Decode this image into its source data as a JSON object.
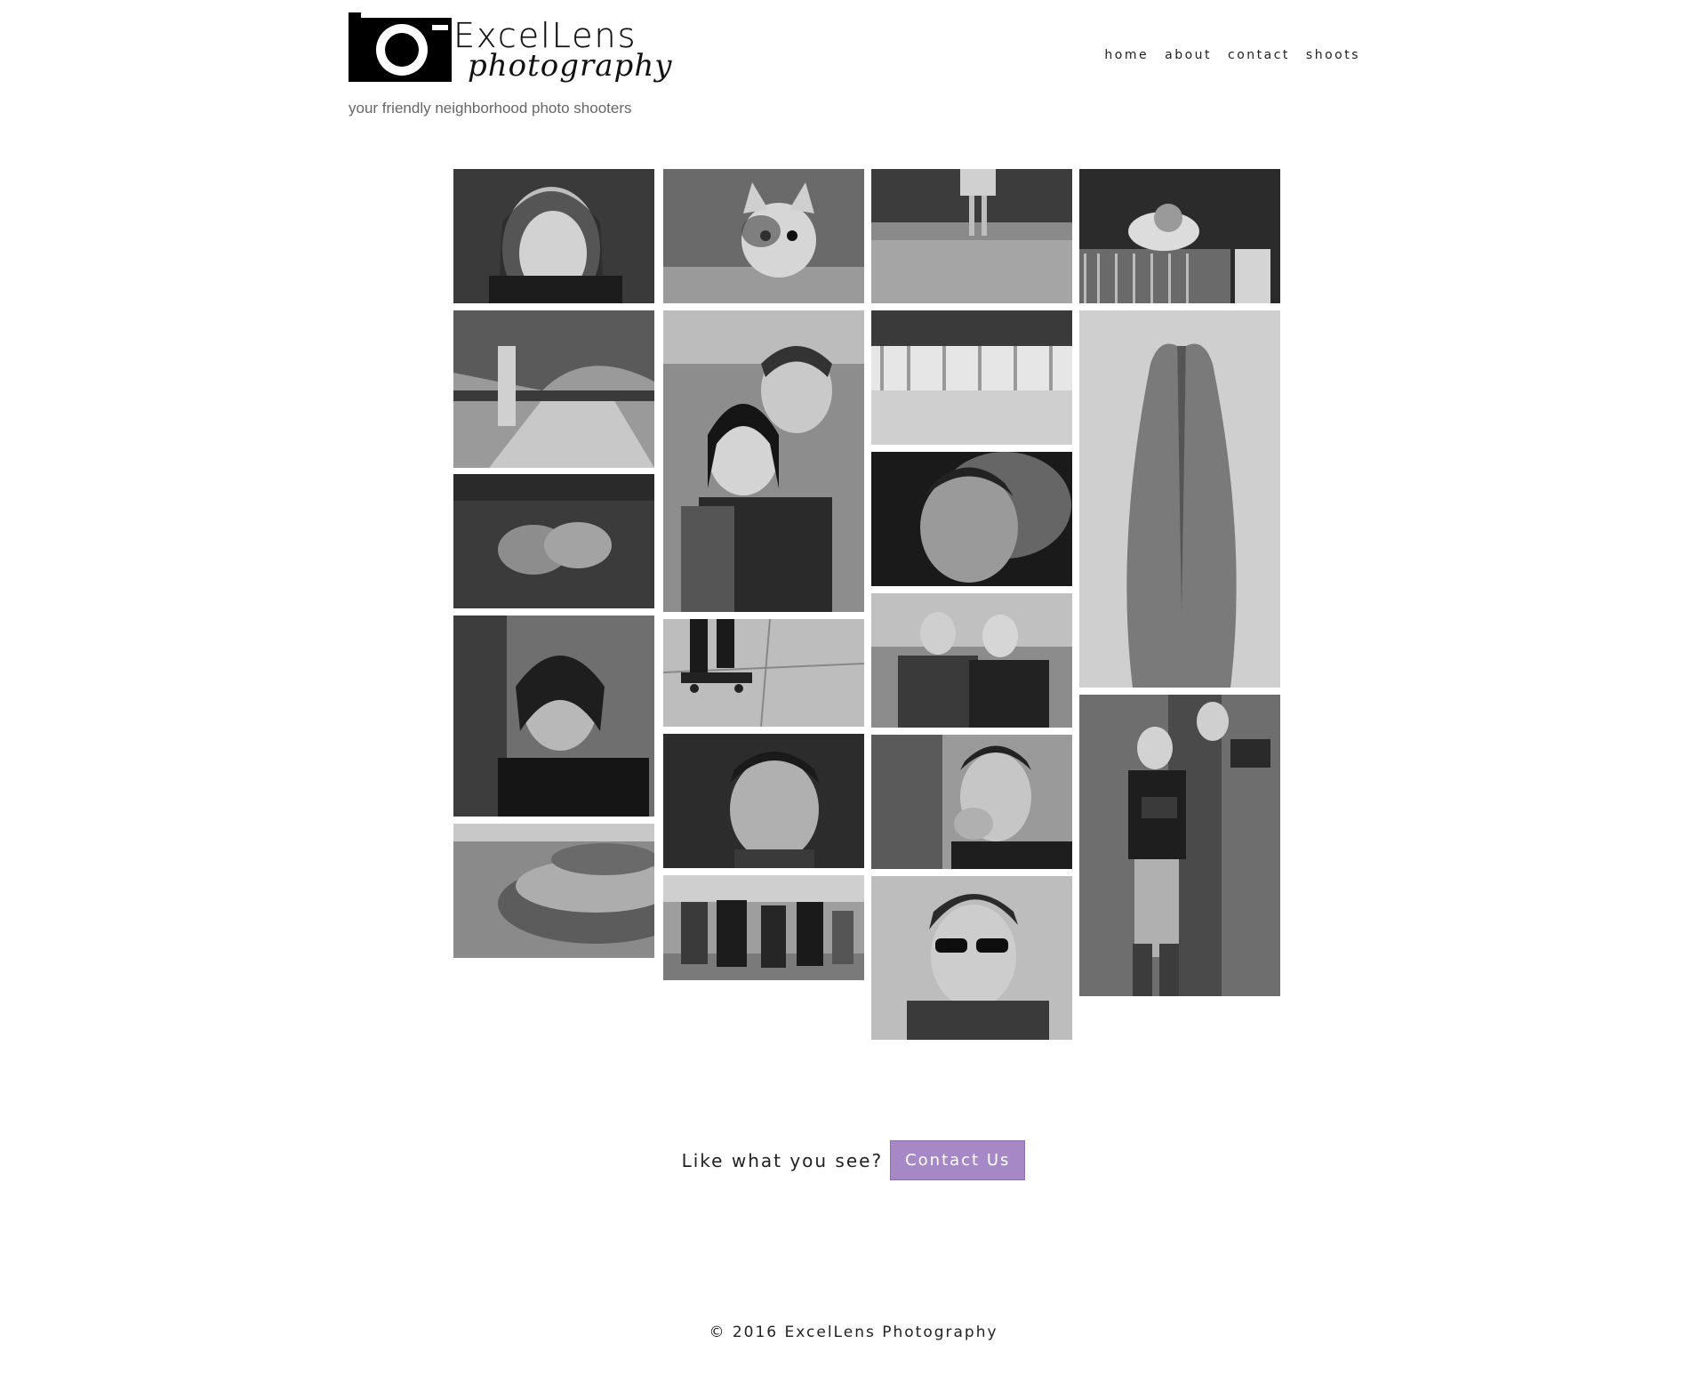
{
  "brand": {
    "logo_word": "ExcelLens",
    "logo_script": "photography",
    "tagline": "your friendly neighborhood photo shooters"
  },
  "nav": {
    "home": "home",
    "about": "about",
    "contact": "contact",
    "shoots": "shoots"
  },
  "gallery": {
    "columns": 4,
    "photo_count": 19,
    "style": "black-and-white"
  },
  "cta": {
    "text": "Like what you see?",
    "button": "Contact Us",
    "button_color": "#a688c6"
  },
  "footer": {
    "copyright": "© 2016 ExcelLens Photography"
  }
}
